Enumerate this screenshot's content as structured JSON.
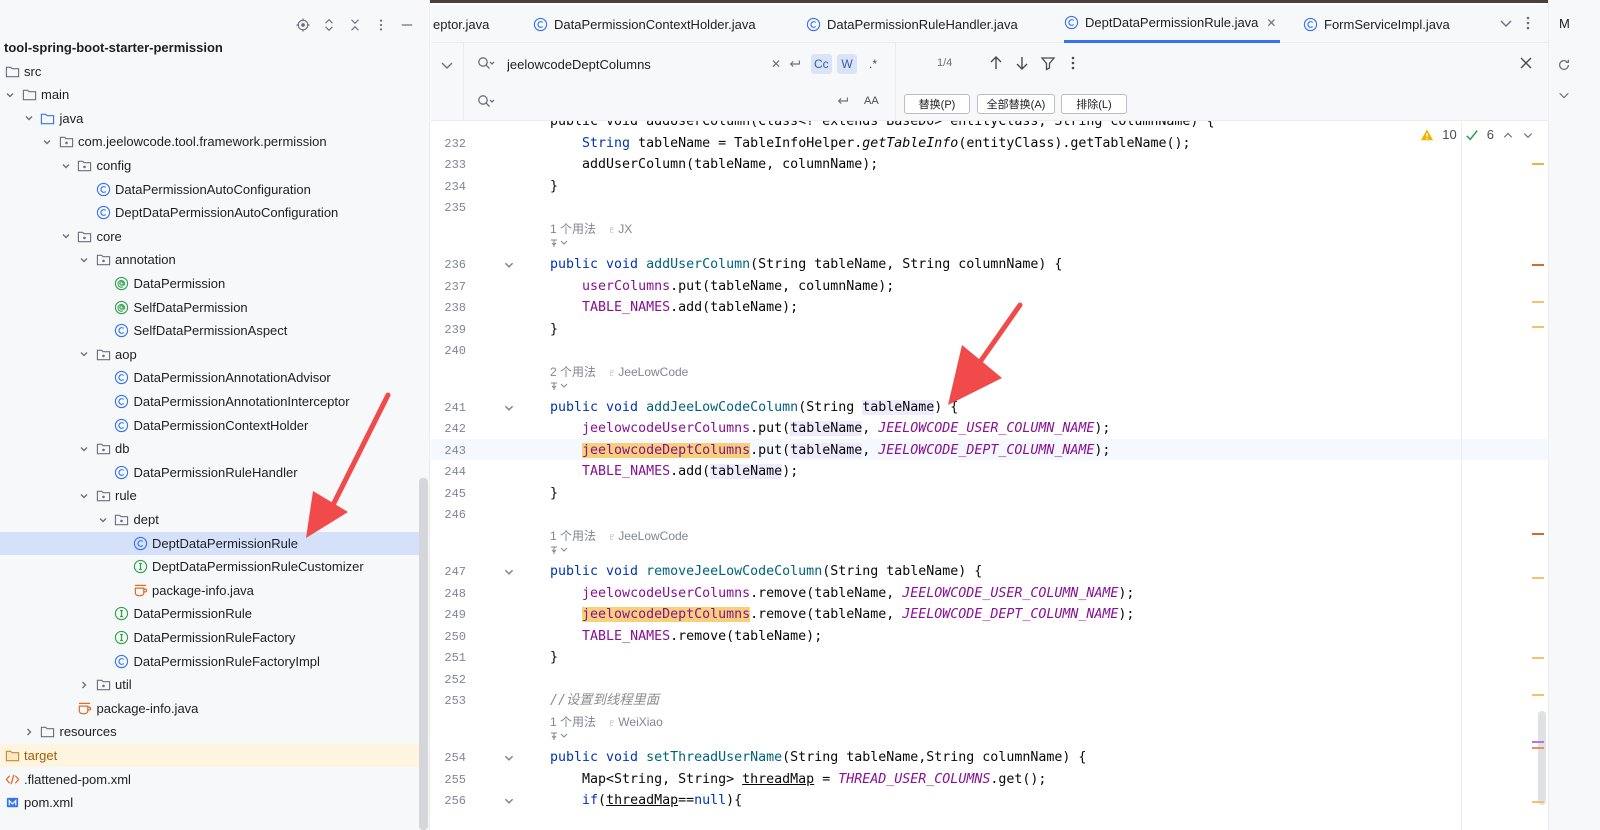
{
  "project": {
    "root": "tool-spring-boot-starter-permission",
    "tree": [
      {
        "label": "tool-spring-boot-starter-permission",
        "depth": 0,
        "chevron": "none",
        "icon": "none",
        "style": "root"
      },
      {
        "label": "src",
        "depth": 0,
        "chevron": "none",
        "icon": "folder"
      },
      {
        "label": "main",
        "depth": 0,
        "chevron": "down",
        "icon": "folder"
      },
      {
        "label": "java",
        "depth": 1,
        "chevron": "down",
        "icon": "folder-blue"
      },
      {
        "label": "com.jeelowcode.tool.framework.permission",
        "depth": 2,
        "chevron": "down",
        "icon": "package"
      },
      {
        "label": "config",
        "depth": 3,
        "chevron": "down",
        "icon": "package"
      },
      {
        "label": "DataPermissionAutoConfiguration",
        "depth": 4,
        "chevron": "none",
        "icon": "class"
      },
      {
        "label": "DeptDataPermissionAutoConfiguration",
        "depth": 4,
        "chevron": "none",
        "icon": "class"
      },
      {
        "label": "core",
        "depth": 3,
        "chevron": "down",
        "icon": "package"
      },
      {
        "label": "annotation",
        "depth": 4,
        "chevron": "down",
        "icon": "package"
      },
      {
        "label": "DataPermission",
        "depth": 5,
        "chevron": "none",
        "icon": "annotation"
      },
      {
        "label": "SelfDataPermission",
        "depth": 5,
        "chevron": "none",
        "icon": "annotation"
      },
      {
        "label": "SelfDataPermissionAspect",
        "depth": 5,
        "chevron": "none",
        "icon": "class"
      },
      {
        "label": "aop",
        "depth": 4,
        "chevron": "down",
        "icon": "package"
      },
      {
        "label": "DataPermissionAnnotationAdvisor",
        "depth": 5,
        "chevron": "none",
        "icon": "class"
      },
      {
        "label": "DataPermissionAnnotationInterceptor",
        "depth": 5,
        "chevron": "none",
        "icon": "class"
      },
      {
        "label": "DataPermissionContextHolder",
        "depth": 5,
        "chevron": "none",
        "icon": "class"
      },
      {
        "label": "db",
        "depth": 4,
        "chevron": "down",
        "icon": "package"
      },
      {
        "label": "DataPermissionRuleHandler",
        "depth": 5,
        "chevron": "none",
        "icon": "class"
      },
      {
        "label": "rule",
        "depth": 4,
        "chevron": "down",
        "icon": "package"
      },
      {
        "label": "dept",
        "depth": 5,
        "chevron": "down",
        "icon": "package"
      },
      {
        "label": "DeptDataPermissionRule",
        "depth": 6,
        "chevron": "none",
        "icon": "class",
        "style": "selected"
      },
      {
        "label": "DeptDataPermissionRuleCustomizer",
        "depth": 6,
        "chevron": "none",
        "icon": "interface"
      },
      {
        "label": "package-info.java",
        "depth": 6,
        "chevron": "none",
        "icon": "java-file"
      },
      {
        "label": "DataPermissionRule",
        "depth": 5,
        "chevron": "none",
        "icon": "interface"
      },
      {
        "label": "DataPermissionRuleFactory",
        "depth": 5,
        "chevron": "none",
        "icon": "interface"
      },
      {
        "label": "DataPermissionRuleFactoryImpl",
        "depth": 5,
        "chevron": "none",
        "icon": "class"
      },
      {
        "label": "util",
        "depth": 4,
        "chevron": "right",
        "icon": "package"
      },
      {
        "label": "package-info.java",
        "depth": 3,
        "chevron": "none",
        "icon": "java-file"
      },
      {
        "label": "resources",
        "depth": 1,
        "chevron": "right",
        "icon": "folder"
      },
      {
        "label": "target",
        "depth": 0,
        "chevron": "none",
        "icon": "folder-orange",
        "style": "orange"
      },
      {
        "label": ".flattened-pom.xml",
        "depth": 0,
        "chevron": "none",
        "icon": "xml"
      },
      {
        "label": "pom.xml",
        "depth": 0,
        "chevron": "none",
        "icon": "maven"
      }
    ]
  },
  "tabs": [
    {
      "label": "eptor.java",
      "icon": "none",
      "active": false
    },
    {
      "label": "DataPermissionContextHolder.java",
      "icon": "class",
      "active": false
    },
    {
      "label": "DataPermissionRuleHandler.java",
      "icon": "class",
      "active": false
    },
    {
      "label": "DeptDataPermissionRule.java",
      "icon": "class",
      "active": true
    },
    {
      "label": "FormServiceImpl.java",
      "icon": "class",
      "active": false
    }
  ],
  "find": {
    "search_value": "jeelowcodeDeptColumns",
    "replace_placeholder": "",
    "match_case": "Cc",
    "words": "W",
    "regex": ".*",
    "preserve_case": "AA",
    "match_count": "1/4",
    "replace_label": "替换(P)",
    "replace_all_label": "全部替换(A)",
    "exclude_label": "排除(L)"
  },
  "inspections": {
    "warnings": "10",
    "ok": "6"
  },
  "right_strip_label": "M",
  "editor": {
    "lines": [
      {
        "n": "232",
        "html": "    <span class='kw'>String</span> tableName = TableInfoHelper.<span class='static'>getTableInfo</span>(entityClass).getTableName();"
      },
      {
        "n": "233",
        "html": "    addUserColumn(tableName, columnName);"
      },
      {
        "n": "234",
        "html": "}"
      },
      {
        "n": "235",
        "html": ""
      },
      {
        "n": "236",
        "html": "<span class='kw'>public void</span> <span class='fn'>addUserColumn</span>(String tableName, String columnName) {"
      },
      {
        "n": "237",
        "html": "    <span class='fld'>userColumns</span>.put(tableName, columnName);"
      },
      {
        "n": "238",
        "html": "    <span class='fld'>TABLE_NAMES</span>.add(tableName);"
      },
      {
        "n": "239",
        "html": "}"
      },
      {
        "n": "240",
        "html": ""
      },
      {
        "n": "241",
        "html": "<span class='kw'>public void</span> <span class='fn'>addJeeLowCodeColumn</span>(String <span class='ref'>tableName</span>) {"
      },
      {
        "n": "242",
        "html": "    <span class='fld'>jeelowcodeUserColumns</span>.put(<span class='ref'>tableName</span>, <span class='const'>JEELOWCODE_USER_COLUMN_NAME</span>);"
      },
      {
        "n": "243",
        "html": "    <span class='match fld'>jeelowcodeDeptColumns</span>.put(<span class='ref'>tableName</span>, <span class='const'>JEELOWCODE_DEPT_COLUMN_NAME</span>);"
      },
      {
        "n": "244",
        "html": "    <span class='fld'>TABLE_NAMES</span>.add(<span class='ref'>tableName</span>);"
      },
      {
        "n": "245",
        "html": "}"
      },
      {
        "n": "246",
        "html": ""
      },
      {
        "n": "247",
        "html": "<span class='kw'>public void</span> <span class='fn'>removeJeeLowCodeColumn</span>(String tableName) {"
      },
      {
        "n": "248",
        "html": "    <span class='fld'>jeelowcodeUserColumns</span>.remove(tableName, <span class='const'>JEELOWCODE_USER_COLUMN_NAME</span>);"
      },
      {
        "n": "249",
        "html": "    <span class='match fld'>jeelowcodeDeptColumns</span>.remove(tableName, <span class='const'>JEELOWCODE_DEPT_COLUMN_NAME</span>);"
      },
      {
        "n": "250",
        "html": "    <span class='fld'>TABLE_NAMES</span>.remove(tableName);"
      },
      {
        "n": "251",
        "html": "}"
      },
      {
        "n": "252",
        "html": ""
      },
      {
        "n": "253",
        "html": "<span class='cmt'>//设置到线程里面</span>"
      },
      {
        "n": "254",
        "html": "<span class='kw'>public void</span> <span class='fn'>setThreadUserName</span>(String tableName,String columnName) {"
      },
      {
        "n": "255",
        "html": "    Map&lt;String, String&gt; <span class='ul'>threadMap</span> = <span class='const'>THREAD_USER_COLUMNS</span>.get();"
      },
      {
        "n": "256",
        "html": "    <span class='kw'>if</span>(<span class='ul'>threadMap</span>==<span class='kw'>null</span>){"
      }
    ],
    "top_partial": "public void addUserColumn(Class<? extends BaseDO> entityClass, String columnName) {",
    "hints": [
      {
        "usages": "1 个用法",
        "author": "JX"
      },
      {
        "usages": "2 个用法",
        "author": "JeeLowCode"
      },
      {
        "usages": "1 个用法",
        "author": "JeeLowCode"
      },
      {
        "usages": "1 个用法",
        "author": "WeiXiao"
      }
    ]
  }
}
